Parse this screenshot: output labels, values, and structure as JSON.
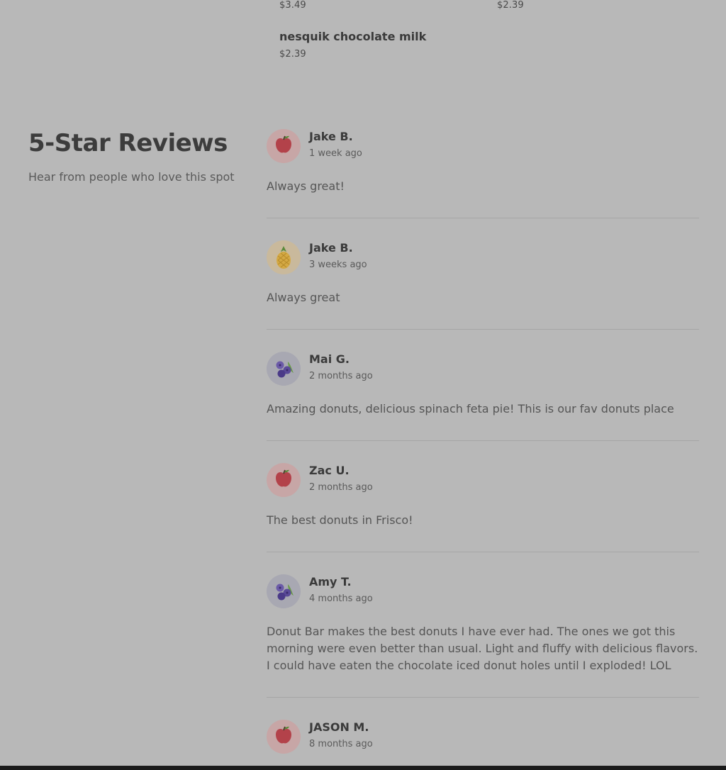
{
  "menu_items": {
    "col1_top_price": "$3.49",
    "col2_top_price": "$2.39",
    "nesquik": {
      "name": "nesquik chocolate milk",
      "price": "$2.39"
    }
  },
  "reviews_section": {
    "title": "5-Star Reviews",
    "subtitle": "Hear from people who love this spot",
    "reviews": [
      {
        "avatar": "apple-icon",
        "name": "Jake B.",
        "time": "1 week ago",
        "text": "Always great!"
      },
      {
        "avatar": "pineapple-icon",
        "name": "Jake B.",
        "time": "3 weeks ago",
        "text": "Always great"
      },
      {
        "avatar": "blueberry-icon",
        "name": "Mai G.",
        "time": "2 months ago",
        "text": "Amazing donuts, delicious spinach feta pie! This is our fav donuts place"
      },
      {
        "avatar": "apple-icon",
        "name": "Zac U.",
        "time": "2 months ago",
        "text": "The best donuts in Frisco!"
      },
      {
        "avatar": "blueberry-icon",
        "name": "Amy T.",
        "time": "4 months ago",
        "text": "Donut Bar makes the best donuts I have ever had. The ones we got this morning were even better than usual. Light and fluffy with delicious flavors. I could have eaten the chocolate iced donut holes until I exploded! LOL"
      },
      {
        "avatar": "apple-icon",
        "name": "JASON M.",
        "time": "8 months ago",
        "text": ""
      }
    ]
  },
  "colors": {
    "overlay_background": "#b8b8b8",
    "heading_text": "#3c3c3c",
    "body_text": "#555555",
    "bottom_bar": "#1a1a1a"
  }
}
